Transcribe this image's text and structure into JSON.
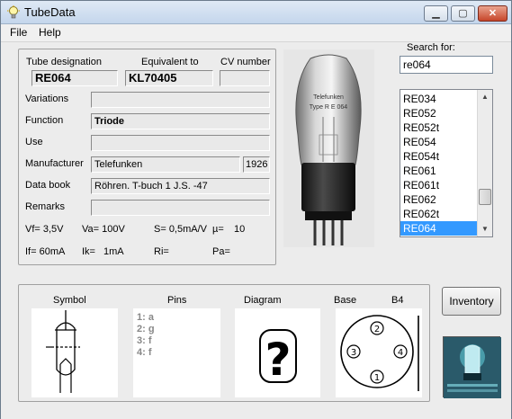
{
  "window": {
    "title": "TubeData"
  },
  "menu": {
    "file": "File",
    "help": "Help"
  },
  "tube": {
    "designation_label": "Tube designation",
    "designation": "RE064",
    "equivalent_label": "Equivalent to",
    "equivalent": "KL70405",
    "cv_label": "CV number",
    "cv": "",
    "variations_label": "Variations",
    "variations": "",
    "function_label": "Function",
    "function": "Triode",
    "use_label": "Use",
    "use": "",
    "manufacturer_label": "Manufacturer",
    "manufacturer": "Telefunken",
    "year": "1926",
    "databook_label": "Data book",
    "databook": "Röhren. T-buch 1 J.S. -47",
    "remarks_label": "Remarks",
    "remarks": ""
  },
  "params": {
    "vf": "Vf= 3,5V",
    "va": "Va= 100V",
    "s": "S= 0,5mA/V",
    "mu": "µ=",
    "mu_value": "10",
    "if": "If= 60mA",
    "ik": "Ik=",
    "ik_value": "1mA",
    "ri": "Ri=",
    "pa": "Pa="
  },
  "photo": {
    "label1": "Telefunken",
    "label2": "Type R E 064"
  },
  "search": {
    "label": "Search for:",
    "value": "re064"
  },
  "list": {
    "items": [
      "RE034",
      "RE052",
      "RE052t",
      "RE054",
      "RE054t",
      "RE061",
      "RE061t",
      "RE062",
      "RE062t",
      "RE064"
    ],
    "selected_index": 9
  },
  "bottom": {
    "symbol_label": "Symbol",
    "pins_label": "Pins",
    "diagram_label": "Diagram",
    "base_label": "Base",
    "base_type": "B4",
    "pins": [
      "1: a",
      "2: g",
      "3: f",
      "4: f"
    ],
    "base_pins": [
      "1",
      "2",
      "3",
      "4"
    ],
    "diagram_placeholder": "?"
  },
  "buttons": {
    "inventory": "Inventory"
  }
}
